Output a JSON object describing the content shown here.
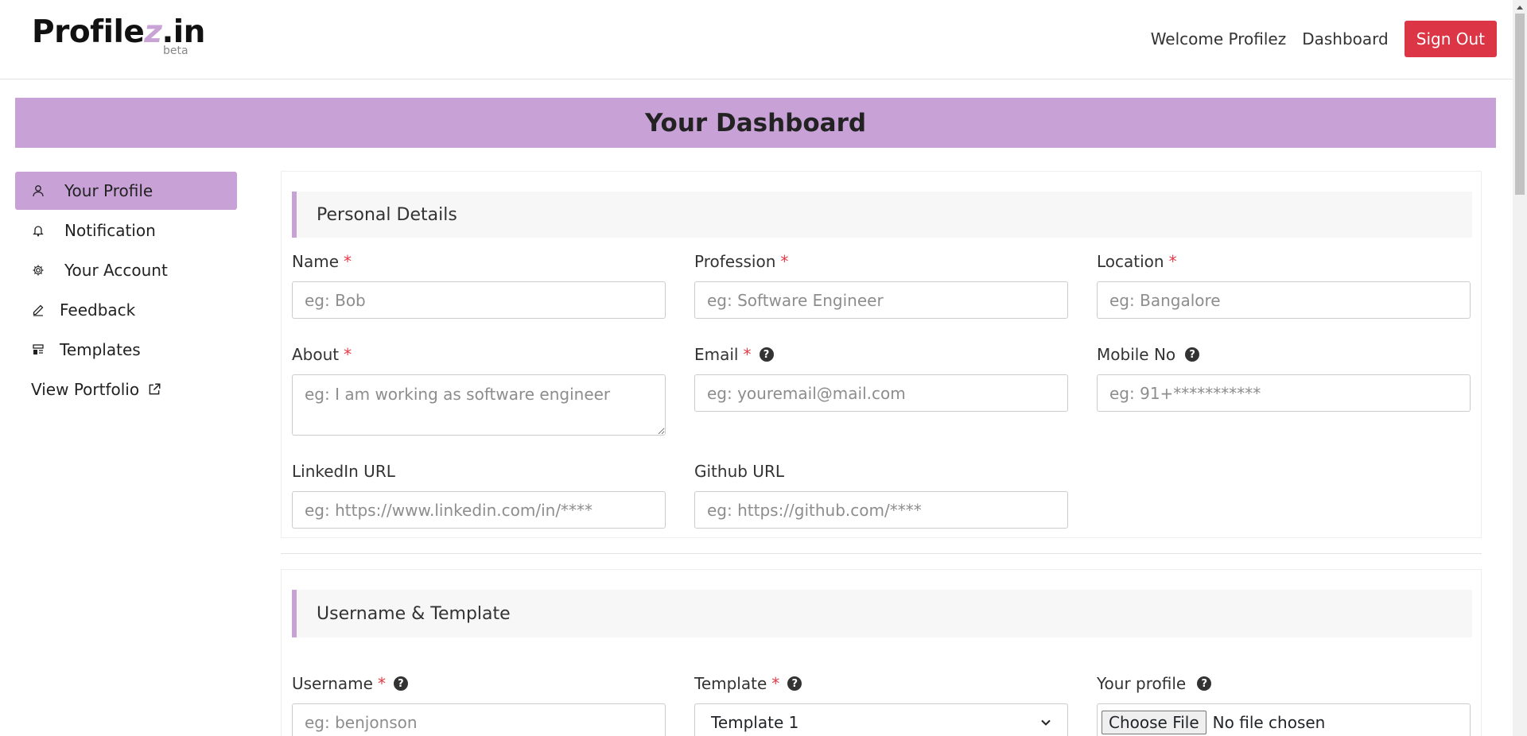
{
  "header": {
    "logo_text": "Profilez.in",
    "logo_beta": "beta",
    "welcome": "Welcome Profilez",
    "dashboard_link": "Dashboard",
    "signout_label": "Sign Out"
  },
  "banner": {
    "title": "Your Dashboard"
  },
  "sidebar": {
    "items": [
      {
        "label": "Your Profile",
        "icon": "user-icon",
        "active": true
      },
      {
        "label": "Notification",
        "icon": "bell-icon",
        "active": false
      },
      {
        "label": "Your Account",
        "icon": "gear-icon",
        "active": false
      },
      {
        "label": "Feedback",
        "icon": "pencil-icon",
        "active": false
      },
      {
        "label": "Templates",
        "icon": "template-icon",
        "active": false
      },
      {
        "label": "View Portfolio",
        "icon": "external-link-icon",
        "active": false
      }
    ]
  },
  "personal": {
    "heading": "Personal Details",
    "name": {
      "label": "Name",
      "required": "*",
      "placeholder": "eg: Bob"
    },
    "profession": {
      "label": "Profession",
      "required": "*",
      "placeholder": "eg: Software Engineer"
    },
    "location": {
      "label": "Location",
      "required": "*",
      "placeholder": "eg: Bangalore"
    },
    "about": {
      "label": "About",
      "required": "*",
      "placeholder": "eg: I am working as software engineer"
    },
    "email": {
      "label": "Email",
      "required": "*",
      "placeholder": "eg: youremail@mail.com"
    },
    "mobile": {
      "label": "Mobile No",
      "placeholder": "eg: 91+***********"
    },
    "linkedin": {
      "label": "LinkedIn URL",
      "placeholder": "eg: https://www.linkedin.com/in/****"
    },
    "github": {
      "label": "Github URL",
      "placeholder": "eg: https://github.com/****"
    }
  },
  "username_template": {
    "heading": "Username & Template",
    "username": {
      "label": "Username",
      "required": "*",
      "placeholder": "eg: benjonson"
    },
    "template": {
      "label": "Template",
      "required": "*",
      "selected": "Template 1"
    },
    "profile": {
      "label": "Your profile",
      "choose_label": "Choose File",
      "status": "No file chosen"
    }
  },
  "help_glyph": "?",
  "colors": {
    "accent": "#c8a2d6",
    "danger": "#dc3545",
    "required": "#e63946"
  }
}
